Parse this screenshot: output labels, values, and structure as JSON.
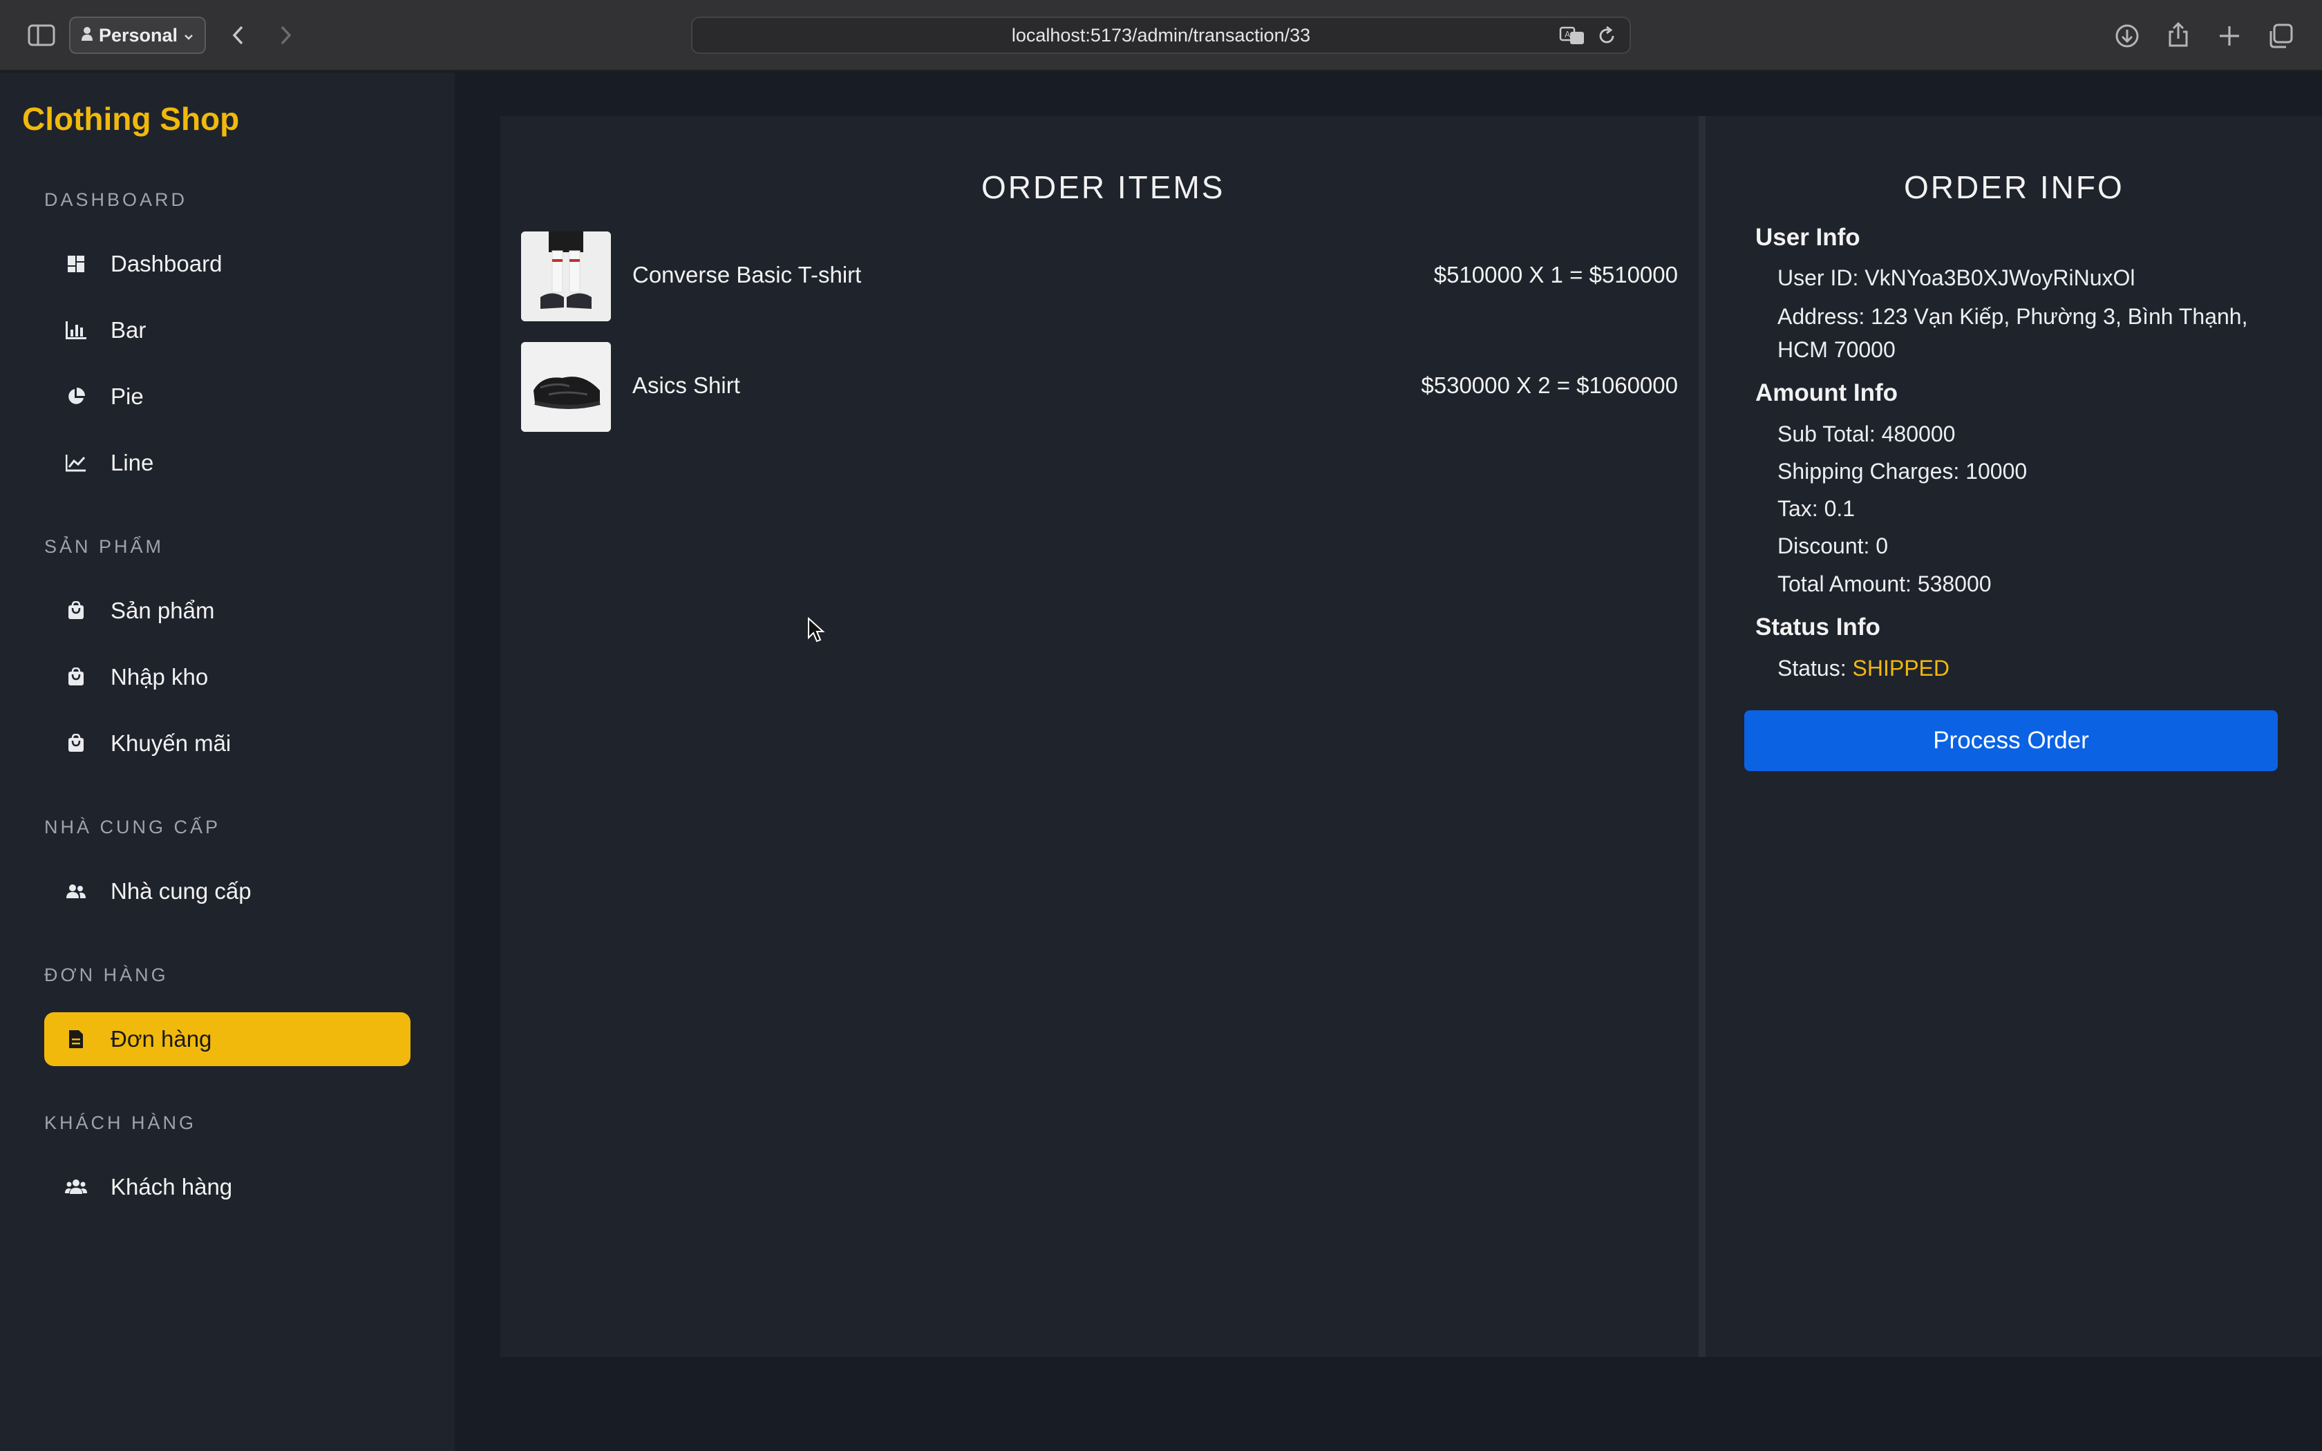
{
  "browser": {
    "profile_label": "Personal",
    "url": "localhost:5173/admin/transaction/33"
  },
  "sidebar": {
    "brand": "Clothing Shop",
    "sections": [
      {
        "label": "DASHBOARD"
      },
      {
        "label": "SẢN PHẨM"
      },
      {
        "label": "NHÀ CUNG CẤP"
      },
      {
        "label": "ĐƠN HÀNG"
      },
      {
        "label": "KHÁCH HÀNG"
      }
    ],
    "items": [
      {
        "label": "Dashboard",
        "icon": "dashboard-icon"
      },
      {
        "label": "Bar",
        "icon": "bar-chart-icon"
      },
      {
        "label": "Pie",
        "icon": "pie-chart-icon"
      },
      {
        "label": "Line",
        "icon": "line-chart-icon"
      },
      {
        "label": "Sản phẩm",
        "icon": "shopping-bag-icon"
      },
      {
        "label": "Nhập kho",
        "icon": "shopping-bag-icon"
      },
      {
        "label": "Khuyến mãi",
        "icon": "shopping-bag-icon"
      },
      {
        "label": "Nhà cung cấp",
        "icon": "people-icon"
      },
      {
        "label": "Đơn hàng",
        "icon": "receipt-icon",
        "active": true
      },
      {
        "label": "Khách hàng",
        "icon": "group-icon"
      }
    ]
  },
  "order_items": {
    "title": "ORDER ITEMS",
    "items": [
      {
        "name": "Converse Basic T-shirt",
        "price_line": "$510000 X 1 = $510000"
      },
      {
        "name": "Asics Shirt",
        "price_line": "$530000 X 2 = $1060000"
      }
    ]
  },
  "order_info": {
    "title": "ORDER INFO",
    "user_info": {
      "heading": "User Info",
      "user_id": "User ID: VkNYoa3B0XJWoyRiNuxOl",
      "address_line1": "Address: 123 Vạn Kiếp, Phường 3, Bình Thạnh,",
      "address_line2": "HCM 70000"
    },
    "amount_info": {
      "heading": "Amount Info",
      "sub_total": "Sub Total: 480000",
      "shipping": "Shipping Charges: 10000",
      "tax": "Tax: 0.1",
      "discount": "Discount: 0",
      "total": "Total Amount: 538000"
    },
    "status_info": {
      "heading": "Status Info",
      "status_label": "Status: ",
      "status_value": "SHIPPED"
    },
    "process_button": "Process Order"
  },
  "colors": {
    "accent": "#f0b90b",
    "primary_button": "#0b63e4",
    "panel": "#1f232b",
    "background": "#181c24"
  }
}
